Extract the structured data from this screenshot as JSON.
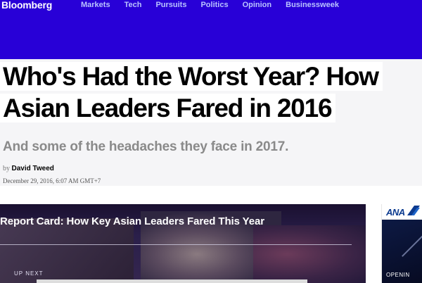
{
  "header": {
    "brand": "Bloomberg",
    "nav": [
      "Markets",
      "Tech",
      "Pursuits",
      "Politics",
      "Opinion",
      "Businessweek"
    ]
  },
  "article": {
    "headline_line1": "Who's Had the Worst Year? How",
    "headline_line2": "Asian Leaders Fared in 2016",
    "dek": "And some of the headaches they face in 2017.",
    "by": "by",
    "author": "David Tweed",
    "date": "December 29, 2016, 6:07 AM GMT+7"
  },
  "video": {
    "title": "Report Card: How Key Asian Leaders Fared This Year",
    "up_next": "UP NEXT"
  },
  "ad": {
    "logo": "ANA",
    "text": "OPENIN"
  },
  "colors": {
    "hero_blue": "#2800d7",
    "nav_text": "#b9c3ff",
    "dek_gray": "#8a8a8a"
  }
}
